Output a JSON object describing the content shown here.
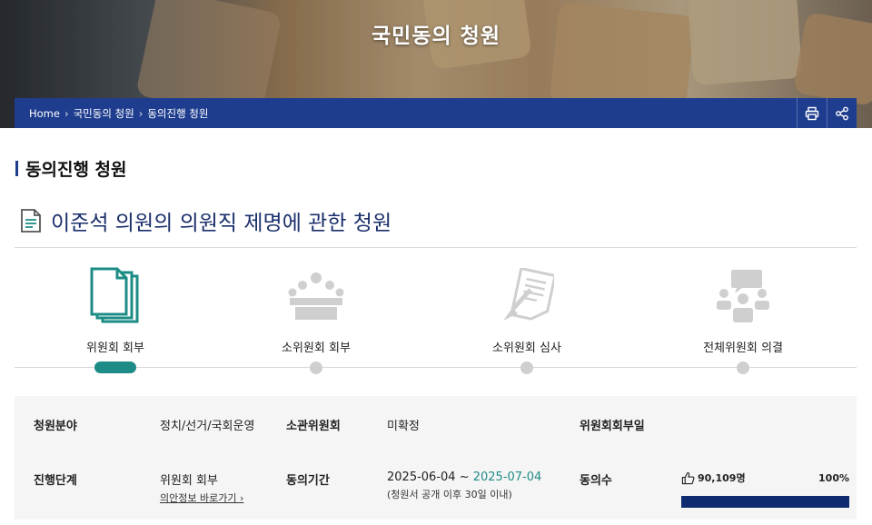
{
  "banner": {
    "title": "국민동의 청원"
  },
  "breadcrumb": {
    "items": [
      "Home",
      "국민동의 청원",
      "동의진행 청원"
    ]
  },
  "section": {
    "title": "동의진행 청원"
  },
  "petition": {
    "title": "이준석 의원의 의원직 제명에 관한 청원"
  },
  "steps": [
    {
      "label": "위원회 회부",
      "icon": "documents-icon",
      "active": true
    },
    {
      "label": "소위원회 회부",
      "icon": "conference-icon",
      "active": false
    },
    {
      "label": "소위원회 심사",
      "icon": "review-icon",
      "active": false
    },
    {
      "label": "전체위원회 의결",
      "icon": "meeting-icon",
      "active": false
    }
  ],
  "info": {
    "field_label": "청원분야",
    "field_value": "정치/선거/국회운영",
    "committee_label": "소관위원회",
    "committee_value": "미확정",
    "referral_date_label": "위원회회부일",
    "referral_date_value": "",
    "stage_label": "진행단계",
    "stage_value": "위원회 회부",
    "stage_link": "의안정보 바로가기",
    "period_label": "동의기간",
    "period_start": "2025-06-04",
    "period_sep": " ~ ",
    "period_end": "2025-07-04",
    "period_note": "(청원서 공개 이후 30일 이내)",
    "consent_label": "동의수",
    "consent_count": "90,109명",
    "consent_percent_text": "100%",
    "consent_fraction": 1.0
  },
  "colors": {
    "navy": "#1f3d8f",
    "teal": "#1e8c86",
    "progress": "#0f2a6e"
  }
}
